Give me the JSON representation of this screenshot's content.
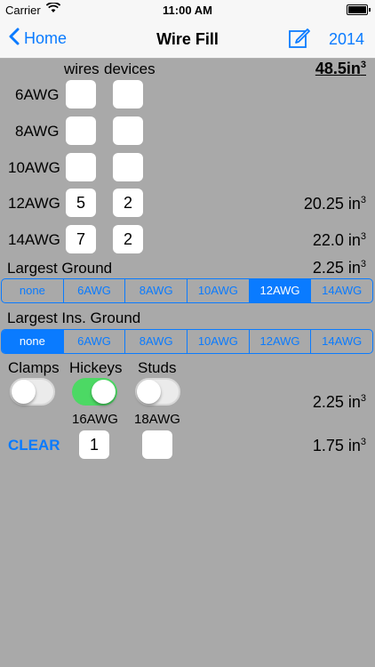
{
  "status": {
    "carrier": "Carrier",
    "time": "11:00 AM"
  },
  "nav": {
    "back_label": "Home",
    "title": "Wire Fill",
    "year_label": "2014"
  },
  "total": {
    "value": "48.5in",
    "sup": "3"
  },
  "headers": {
    "wires": "wires",
    "devices": "devices"
  },
  "rows": [
    {
      "label": "6AWG",
      "wires": "",
      "devices": "",
      "volume": "",
      "unit": ""
    },
    {
      "label": "8AWG",
      "wires": "",
      "devices": "",
      "volume": "",
      "unit": ""
    },
    {
      "label": "10AWG",
      "wires": "",
      "devices": "",
      "volume": "",
      "unit": ""
    },
    {
      "label": "12AWG",
      "wires": "5",
      "devices": "2",
      "volume": "20.25 in",
      "unit": "3"
    },
    {
      "label": "14AWG",
      "wires": "7",
      "devices": "2",
      "volume": "22.0 in",
      "unit": "3"
    }
  ],
  "largest_ground": {
    "label": "Largest Ground",
    "volume": "2.25 in",
    "unit": "3",
    "selected": "12AWG"
  },
  "largest_ins_ground": {
    "label": "Largest Ins. Ground",
    "selected": "none"
  },
  "segment_options": [
    "none",
    "6AWG",
    "8AWG",
    "10AWG",
    "12AWG",
    "14AWG"
  ],
  "toggles": [
    {
      "label": "Clamps",
      "on": false
    },
    {
      "label": "Hickeys",
      "on": true
    },
    {
      "label": "Studs",
      "on": false
    }
  ],
  "toggles_volume": {
    "value": "2.25 in",
    "unit": "3"
  },
  "bottom": {
    "clear_label": "CLEAR",
    "awg16_label": "16AWG",
    "awg16_value": "1",
    "awg18_label": "18AWG",
    "awg18_value": "",
    "volume": "1.75 in",
    "unit": "3"
  },
  "colors": {
    "accent": "#0a7bff",
    "background": "#a9a9a9",
    "toggle_on": "#4cd964"
  }
}
